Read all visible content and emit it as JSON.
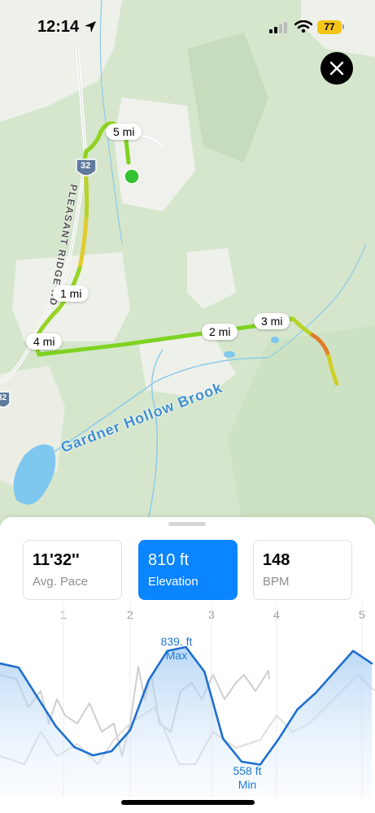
{
  "status_bar": {
    "time": "12:14",
    "battery": "77"
  },
  "map": {
    "road_name": "PLEASANT RIDGE RD",
    "route_shield": "32",
    "route_shield_2": "32",
    "brook_name": "Gardner Hollow Brook",
    "mile_markers": [
      "1 mi",
      "2 mi",
      "3 mi",
      "4 mi",
      "5 mi"
    ]
  },
  "metrics": [
    {
      "value": "11'32''",
      "label": "Avg. Pace"
    },
    {
      "value": "810 ft",
      "label": "Elevation"
    },
    {
      "value": "148",
      "label": "BPM"
    }
  ],
  "chart": {
    "mile_ticks": [
      "1",
      "2",
      "3",
      "4",
      "5"
    ],
    "max_value": "839. ft",
    "max_label": "Max",
    "min_value": "558 ft",
    "min_label": "Min"
  },
  "colors": {
    "accent": "#0a84ff",
    "route_green": "#7ed321",
    "route_red": "#e8412c"
  },
  "chart_data": {
    "type": "line",
    "x": [
      0,
      0.25,
      0.5,
      0.75,
      1.0,
      1.25,
      1.5,
      1.75,
      2.0,
      2.25,
      2.5,
      2.75,
      3.0,
      3.25,
      3.5,
      3.75,
      4.0,
      4.25,
      4.5,
      4.75,
      5.0
    ],
    "series": [
      {
        "values": [
          800,
          790,
          720,
          650,
          600,
          580,
          590,
          640,
          760,
          830,
          839,
          780,
          620,
          565,
          558,
          620,
          690,
          730,
          780,
          830,
          800
        ]
      }
    ],
    "xlabel": "",
    "ylabel": ""
  }
}
